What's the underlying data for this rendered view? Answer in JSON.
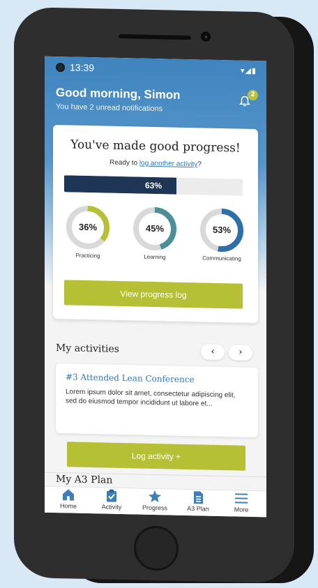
{
  "status_bar": {
    "time": "13:39",
    "icons": "▾◢▮"
  },
  "header": {
    "greeting": "Good morning, Simon",
    "subtitle": "You have 2 unread notifications",
    "notification_count": "2"
  },
  "progress_card": {
    "title": "You've made good progress!",
    "prompt_prefix": "Ready to ",
    "prompt_link": "log another activity",
    "prompt_suffix": "?",
    "overall_label": "63%",
    "overall_value": 0.63,
    "rings": [
      {
        "label": "Practicing",
        "pct_label": "36%",
        "value": 0.36,
        "color": "#b5c035"
      },
      {
        "label": "Learning",
        "pct_label": "45%",
        "value": 0.45,
        "color": "#4a9096"
      },
      {
        "label": "Communicating",
        "pct_label": "53%",
        "value": 0.53,
        "color": "#2f6fa8"
      }
    ],
    "button_label": "View progress log"
  },
  "activities": {
    "section_title": "My activities",
    "prev_label": "‹",
    "next_label": "›",
    "item": {
      "title": "#3 Attended Lean Conference",
      "body": "Lorem ipsum dolor sit amet, consectetur adipiscing elit, sed do eiusmod tempor incididunt ut labore et..."
    },
    "log_button_label": "Log activity +"
  },
  "a3_plan": {
    "section_title": "My A3 Plan"
  },
  "tabbar": {
    "tabs": [
      {
        "label": "Home"
      },
      {
        "label": "Activity"
      },
      {
        "label": "Progress"
      },
      {
        "label": "A3 Plan"
      },
      {
        "label": "More"
      }
    ]
  },
  "colors": {
    "accent_green": "#b5c035",
    "navy": "#1e3556",
    "link_blue": "#2f78b8",
    "icon_blue": "#3f7fb8"
  }
}
